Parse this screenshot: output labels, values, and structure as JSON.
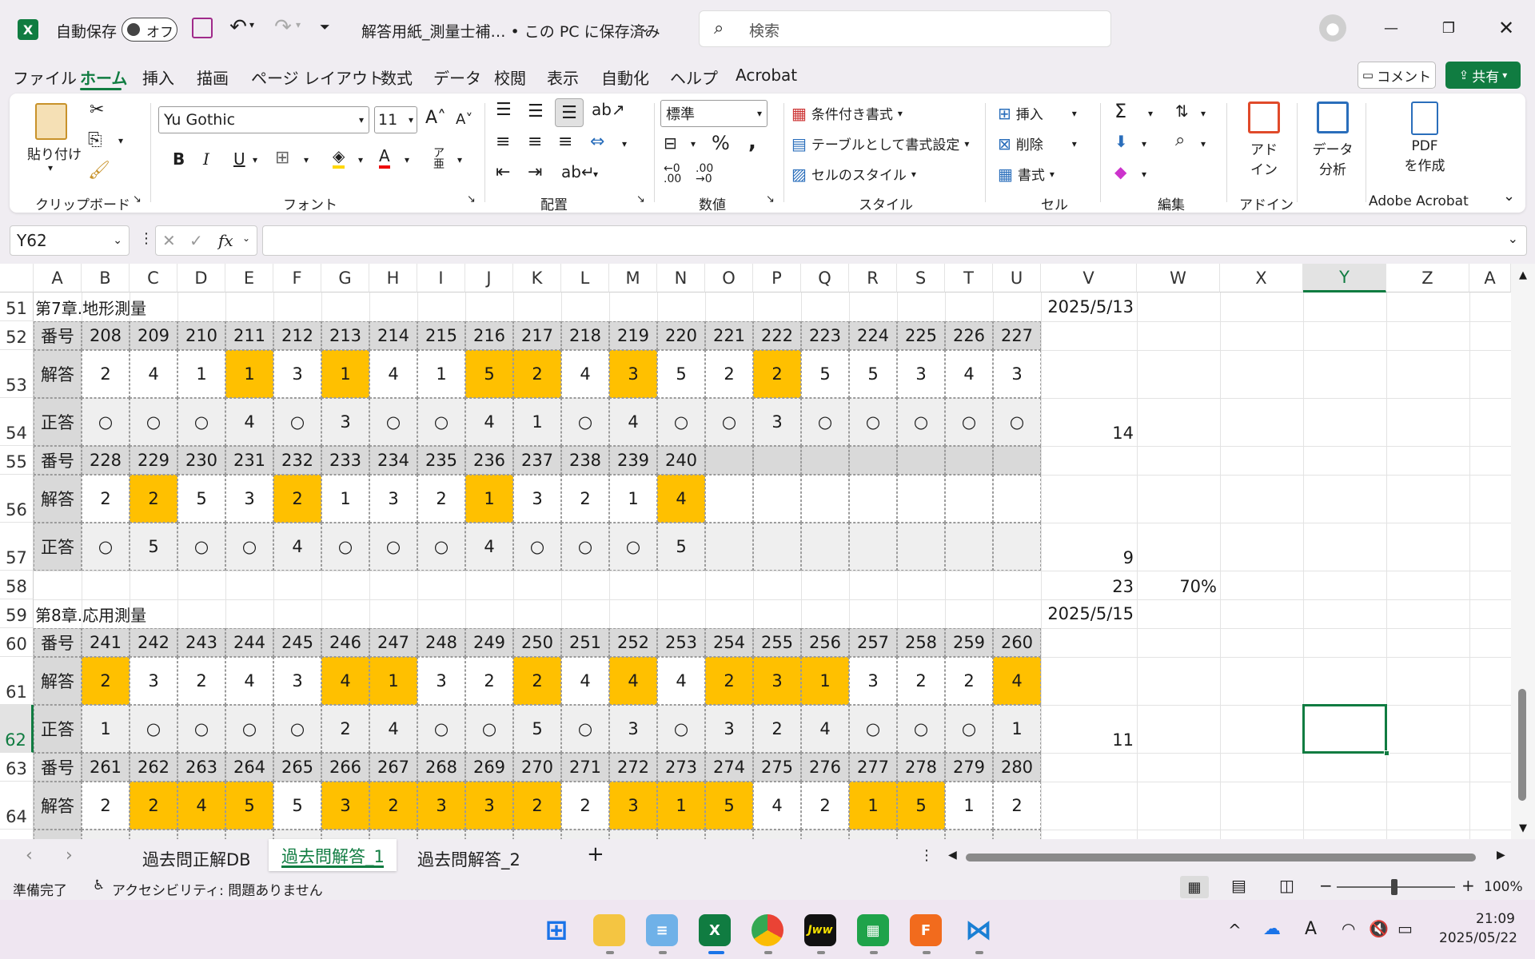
{
  "app": {
    "autosave_label": "自動保存",
    "autosave_state": "オフ",
    "file_title": "解答用紙_測量士補… • この PC に保存済み",
    "search_placeholder": "検索",
    "brand_color": "#107c41"
  },
  "ribbon_tabs": [
    "ファイル",
    "ホーム",
    "挿入",
    "描画",
    "ページ レイアウト",
    "数式",
    "データ",
    "校閲",
    "表示",
    "自動化",
    "ヘルプ",
    "Acrobat"
  ],
  "ribbon_tab_active": "ホーム",
  "header_buttons": {
    "comment": "コメント",
    "share": "共有"
  },
  "ribbon": {
    "clipboard": {
      "paste": "貼り付け",
      "group": "クリップボード"
    },
    "font": {
      "name": "Yu Gothic",
      "size": "11",
      "group": "フォント"
    },
    "alignment": {
      "group": "配置"
    },
    "number": {
      "format": "標準",
      "group": "数値"
    },
    "styles": {
      "conditional": "条件付き書式",
      "table": "テーブルとして書式設定",
      "cell_style": "セルのスタイル",
      "group": "スタイル"
    },
    "cells": {
      "insert": "挿入",
      "delete": "削除",
      "format": "書式",
      "group": "セル"
    },
    "editing": {
      "group": "編集"
    },
    "addin": {
      "label1": "アド",
      "label2": "イン",
      "group": "アドイン"
    },
    "analysis": {
      "label1": "データ",
      "label2": "分析"
    },
    "acrobat": {
      "label1": "PDF",
      "label2": "を作成",
      "group": "Adobe Acrobat"
    }
  },
  "formula_bar": {
    "name_box": "Y62",
    "fx": "fx",
    "content": ""
  },
  "columns": [
    "A",
    "B",
    "C",
    "D",
    "E",
    "F",
    "G",
    "H",
    "I",
    "J",
    "K",
    "L",
    "M",
    "N",
    "O",
    "P",
    "Q",
    "R",
    "S",
    "T",
    "U",
    "V",
    "W",
    "X",
    "Y",
    "Z",
    "A"
  ],
  "selected_column": "Y",
  "selected_row": "62",
  "sheet": {
    "ch7_title": "第7章.地形測量",
    "ch7_date": "2025/5/13",
    "ch8_title": "第8章.応用測量",
    "ch8_date": "2025/5/15",
    "label_no": "番号",
    "label_ans": "解答",
    "label_correct": "正答",
    "r52": [
      "208",
      "209",
      "210",
      "211",
      "212",
      "213",
      "214",
      "215",
      "216",
      "217",
      "218",
      "219",
      "220",
      "221",
      "222",
      "223",
      "224",
      "225",
      "226",
      "227"
    ],
    "r53": [
      "2",
      "4",
      "1",
      "1",
      "3",
      "1",
      "4",
      "1",
      "5",
      "2",
      "4",
      "3",
      "5",
      "2",
      "2",
      "5",
      "5",
      "3",
      "4",
      "3"
    ],
    "r53_hl": [
      0,
      0,
      0,
      1,
      0,
      1,
      0,
      0,
      1,
      1,
      0,
      1,
      0,
      0,
      1,
      0,
      0,
      0,
      0,
      0
    ],
    "r54": [
      "○",
      "○",
      "○",
      "4",
      "○",
      "3",
      "○",
      "○",
      "4",
      "1",
      "○",
      "4",
      "○",
      "○",
      "3",
      "○",
      "○",
      "○",
      "○",
      "○"
    ],
    "r54_v": "14",
    "r55": [
      "228",
      "229",
      "230",
      "231",
      "232",
      "233",
      "234",
      "235",
      "236",
      "237",
      "238",
      "239",
      "240",
      "",
      "",
      "",
      "",
      "",
      "",
      ""
    ],
    "r56": [
      "2",
      "2",
      "5",
      "3",
      "2",
      "1",
      "3",
      "2",
      "1",
      "3",
      "2",
      "1",
      "4",
      "",
      "",
      "",
      "",
      "",
      "",
      ""
    ],
    "r56_hl": [
      0,
      1,
      0,
      0,
      1,
      0,
      0,
      0,
      1,
      0,
      0,
      0,
      1,
      0,
      0,
      0,
      0,
      0,
      0,
      0
    ],
    "r57": [
      "○",
      "5",
      "○",
      "○",
      "4",
      "○",
      "○",
      "○",
      "4",
      "○",
      "○",
      "○",
      "5",
      "",
      "",
      "",
      "",
      "",
      "",
      ""
    ],
    "r57_v": "9",
    "r58_v": "23",
    "r58_w": "70%",
    "r60": [
      "241",
      "242",
      "243",
      "244",
      "245",
      "246",
      "247",
      "248",
      "249",
      "250",
      "251",
      "252",
      "253",
      "254",
      "255",
      "256",
      "257",
      "258",
      "259",
      "260"
    ],
    "r61": [
      "2",
      "3",
      "2",
      "4",
      "3",
      "4",
      "1",
      "3",
      "2",
      "2",
      "4",
      "4",
      "4",
      "2",
      "3",
      "1",
      "3",
      "2",
      "2",
      "4"
    ],
    "r61_hl": [
      1,
      0,
      0,
      0,
      0,
      1,
      1,
      0,
      0,
      1,
      0,
      1,
      0,
      1,
      1,
      1,
      0,
      0,
      0,
      1
    ],
    "r62": [
      "1",
      "○",
      "○",
      "○",
      "○",
      "2",
      "4",
      "○",
      "○",
      "5",
      "○",
      "3",
      "○",
      "3",
      "2",
      "4",
      "○",
      "○",
      "○",
      "1"
    ],
    "r62_v": "11",
    "r63": [
      "261",
      "262",
      "263",
      "264",
      "265",
      "266",
      "267",
      "268",
      "269",
      "270",
      "271",
      "272",
      "273",
      "274",
      "275",
      "276",
      "277",
      "278",
      "279",
      "280"
    ],
    "r64": [
      "2",
      "2",
      "4",
      "5",
      "5",
      "3",
      "2",
      "3",
      "3",
      "2",
      "2",
      "3",
      "1",
      "5",
      "4",
      "2",
      "1",
      "5",
      "1",
      "2"
    ],
    "r64_hl": [
      0,
      1,
      1,
      1,
      0,
      1,
      1,
      1,
      1,
      1,
      0,
      1,
      1,
      1,
      0,
      0,
      1,
      1,
      0,
      0
    ],
    "highlight_color": "#ffc000",
    "header_gray": "#d9d9d9",
    "light_gray": "#efefef"
  },
  "sheet_tabs": [
    "過去問正解DB",
    "過去問解答_1",
    "過去問解答_2"
  ],
  "active_sheet": "過去問解答_1",
  "status": {
    "ready": "準備完了",
    "accessibility": "アクセシビリティ: 問題ありません",
    "zoom": "100%"
  },
  "taskbar": {
    "time": "21:09",
    "date": "2025/05/22"
  }
}
